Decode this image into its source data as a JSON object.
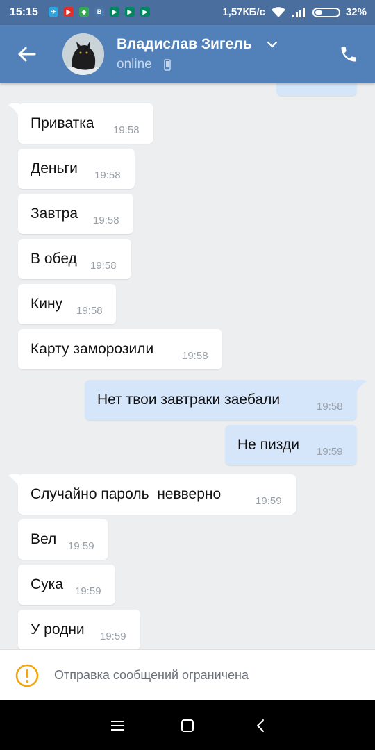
{
  "status_bar": {
    "time": "15:15",
    "speed": "1,57КБ/с",
    "battery": "32%",
    "battery_level": 0.32,
    "apps": [
      "telegram-icon",
      "youtube-icon",
      "maps-icon",
      "vk-icon",
      "play-icon",
      "play-icon",
      "play-icon"
    ]
  },
  "header": {
    "contact_name": "Владислав Зигель",
    "status": "online"
  },
  "messages": [
    {
      "direction": "in",
      "text": "Приватка",
      "time": "19:58"
    },
    {
      "direction": "in",
      "text": "Деньги",
      "time": "19:58"
    },
    {
      "direction": "in",
      "text": "Завтра",
      "time": "19:58"
    },
    {
      "direction": "in",
      "text": "В обед",
      "time": "19:58"
    },
    {
      "direction": "in",
      "text": "Кину",
      "time": "19:58"
    },
    {
      "direction": "in",
      "text": "Карту заморозили",
      "time": "19:58"
    },
    {
      "direction": "out",
      "text": "Нет твои завтраки заебали",
      "time": "19:58"
    },
    {
      "direction": "out",
      "text": "Не пизди",
      "time": "19:59"
    },
    {
      "direction": "in",
      "text": "Случайно пароль  невверно",
      "time": "19:59"
    },
    {
      "direction": "in",
      "text": "Вел",
      "time": "19:59"
    },
    {
      "direction": "in",
      "text": "Сука",
      "time": "19:59"
    },
    {
      "direction": "in",
      "text": "У родни",
      "time": "19:59"
    }
  ],
  "restriction": {
    "text": "Отправка сообщений ограничена"
  },
  "colors": {
    "header": "#5181b8",
    "status_bar": "#4a6f9e",
    "incoming": "#ffffff",
    "outgoing": "#d5e5fa",
    "warning": "#f2a50c"
  }
}
